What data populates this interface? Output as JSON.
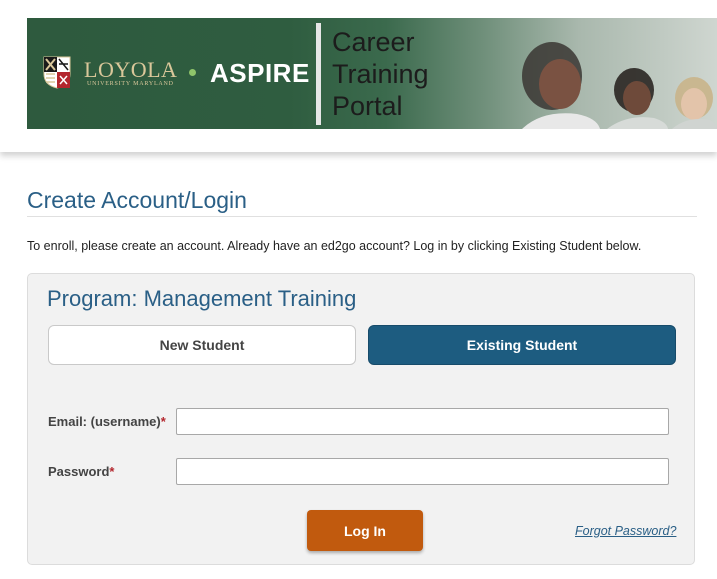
{
  "banner": {
    "university_name": "LOYOLA",
    "university_sub": "UNIVERSITY MARYLAND",
    "program_brand": "ASPIRE",
    "portal_title_lines": [
      "Career",
      "Training",
      "Portal"
    ]
  },
  "page": {
    "title": "Create Account/Login",
    "intro": "To enroll, please create an account. Already have an ed2go account? Log in by clicking Existing Student below."
  },
  "card": {
    "program_title": "Program: Management Training",
    "tabs": [
      {
        "label": "New Student",
        "selected": false
      },
      {
        "label": "Existing Student",
        "selected": true
      }
    ],
    "fields": {
      "email_label": "Email: (username)",
      "email_value": "",
      "password_label": "Password",
      "password_value": "",
      "required_marker": "*"
    },
    "login_label": "Log In",
    "forgot_label": "Forgot Password?"
  },
  "colors": {
    "accent_blue": "#1d5c80",
    "link_blue": "#2a5f86",
    "login_orange": "#c15a0e",
    "required_red": "#b3262d",
    "banner_green": "#2e5a3e"
  }
}
